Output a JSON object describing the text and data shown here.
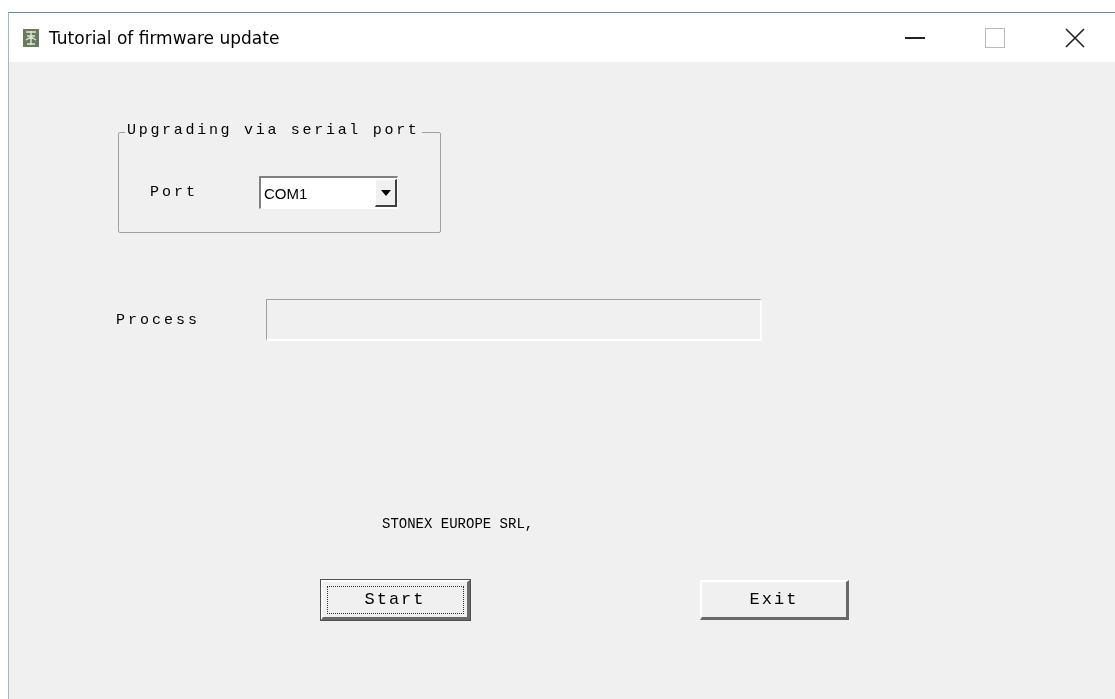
{
  "window": {
    "title": "Tutorial of firmware update"
  },
  "serial_group": {
    "title": "Upgrading via serial port",
    "port_label": "Port",
    "port_value": "COM1"
  },
  "process": {
    "label": "Process",
    "level": 0
  },
  "footer_text": "STONEX EUROPE SRL,",
  "buttons": [
    {
      "label": "Start",
      "focused": true
    },
    {
      "label": "Exit",
      "focused": false
    }
  ]
}
